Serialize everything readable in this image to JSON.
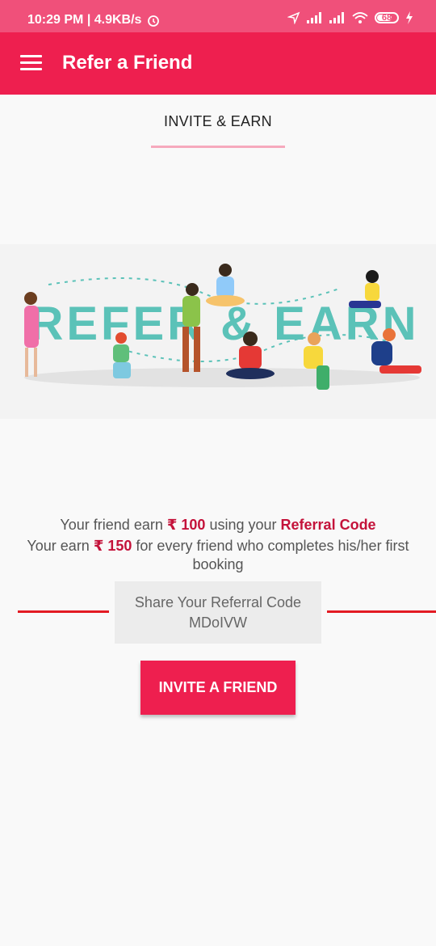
{
  "status_bar": {
    "time_speed": "10:29 PM | 4.9KB/s",
    "battery": "68",
    "icons": [
      "alarm-icon",
      "location-icon",
      "signal-icon",
      "signal-icon",
      "wifi-icon",
      "battery-icon",
      "charging-icon"
    ]
  },
  "app_bar": {
    "title": "Refer a Friend",
    "menu_icon": "menu-icon"
  },
  "tab": {
    "label": "INVITE & EARN"
  },
  "banner": {
    "text": "REFER & EARN"
  },
  "info": {
    "line1_prefix": "Your friend earn",
    "line1_amount": "₹ 100",
    "line1_mid": "using your",
    "line1_bold": "Referral Code",
    "line2_prefix": "Your earn",
    "line2_amount": "₹ 150",
    "line2_suffix": "for every friend who completes his/her first",
    "line3": "booking"
  },
  "referral": {
    "label": "Share Your Referral Code",
    "code": "MDoIVW"
  },
  "invite_button": {
    "label": "INVITE A FRIEND"
  },
  "colors": {
    "primary": "#ee1f4f",
    "status_bar": "#f0507a",
    "accent_text": "#c4123a",
    "banner_letters": "#5bc2b8"
  }
}
